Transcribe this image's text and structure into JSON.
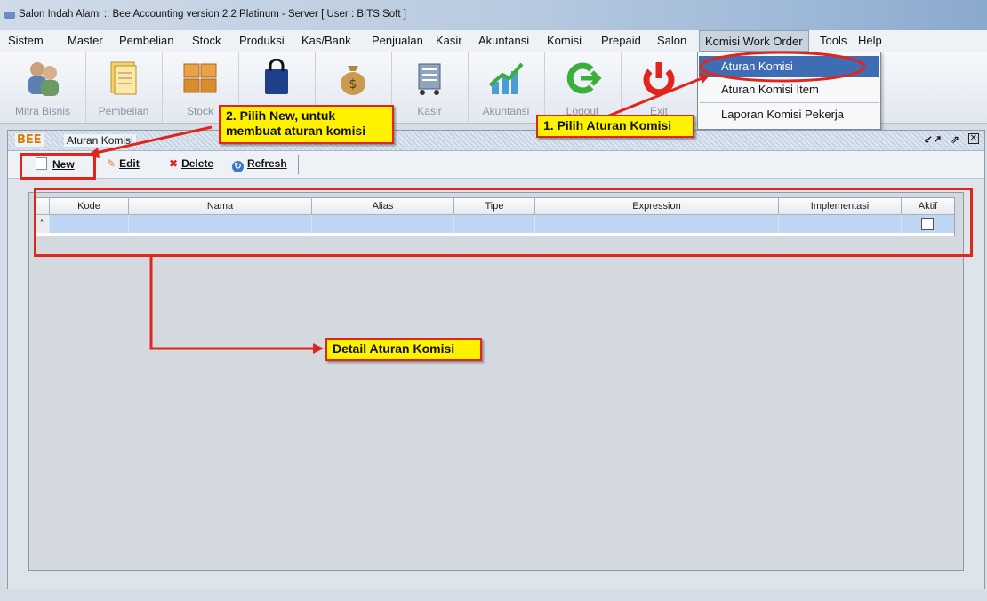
{
  "window": {
    "title": "Salon Indah Alami :: Bee Accounting version 2.2 Platinum - Server  [ User : BITS Soft ]"
  },
  "menubar": {
    "items": [
      "Sistem",
      "Master",
      "Pembelian",
      "Stock",
      "Produksi",
      "Kas/Bank",
      "Penjualan",
      "Kasir",
      "Akuntansi",
      "Komisi",
      "Prepaid",
      "Salon",
      "Komisi Work Order",
      "Tools",
      "Help"
    ]
  },
  "toolbar": {
    "buttons": [
      {
        "label": "Mitra Bisnis",
        "icon": "people-icon"
      },
      {
        "label": "Pembelian",
        "icon": "documents-icon"
      },
      {
        "label": "Stock",
        "icon": "boxes-icon"
      },
      {
        "label": "",
        "icon": "shopping-bag-icon"
      },
      {
        "label": "",
        "icon": "money-bag-icon"
      },
      {
        "label": "Kasir",
        "icon": "cart-icon"
      },
      {
        "label": "Akuntansi",
        "icon": "growth-chart-icon"
      },
      {
        "label": "Logout",
        "icon": "logout-arrow-icon"
      },
      {
        "label": "Exit",
        "icon": "power-icon"
      }
    ]
  },
  "dropdown": {
    "items": [
      "Aturan Komisi",
      "Aturan Komisi Item",
      "Laporan Komisi Pekerja"
    ]
  },
  "frame": {
    "logo": "BEE",
    "title": "Aturan Komisi"
  },
  "actions": {
    "new": "New",
    "edit": "Edit",
    "delete": "Delete",
    "refresh": "Refresh"
  },
  "grid": {
    "columns": [
      "Kode",
      "Nama",
      "Alias",
      "Tipe",
      "Expression",
      "Implementasi",
      "Aktif"
    ],
    "row_marker": "*"
  },
  "annotations": {
    "step1": "1. Pilih Aturan Komisi",
    "step2_line1": "2. Pilih New, untuk",
    "step2_line2": "membuat aturan komisi",
    "detail": "Detail Aturan Komisi"
  },
  "colors": {
    "annotation_red": "#e0261c",
    "annotation_yellow": "#fff200",
    "selection_blue": "#3f6db3",
    "row_blue": "#bcd6f3"
  }
}
